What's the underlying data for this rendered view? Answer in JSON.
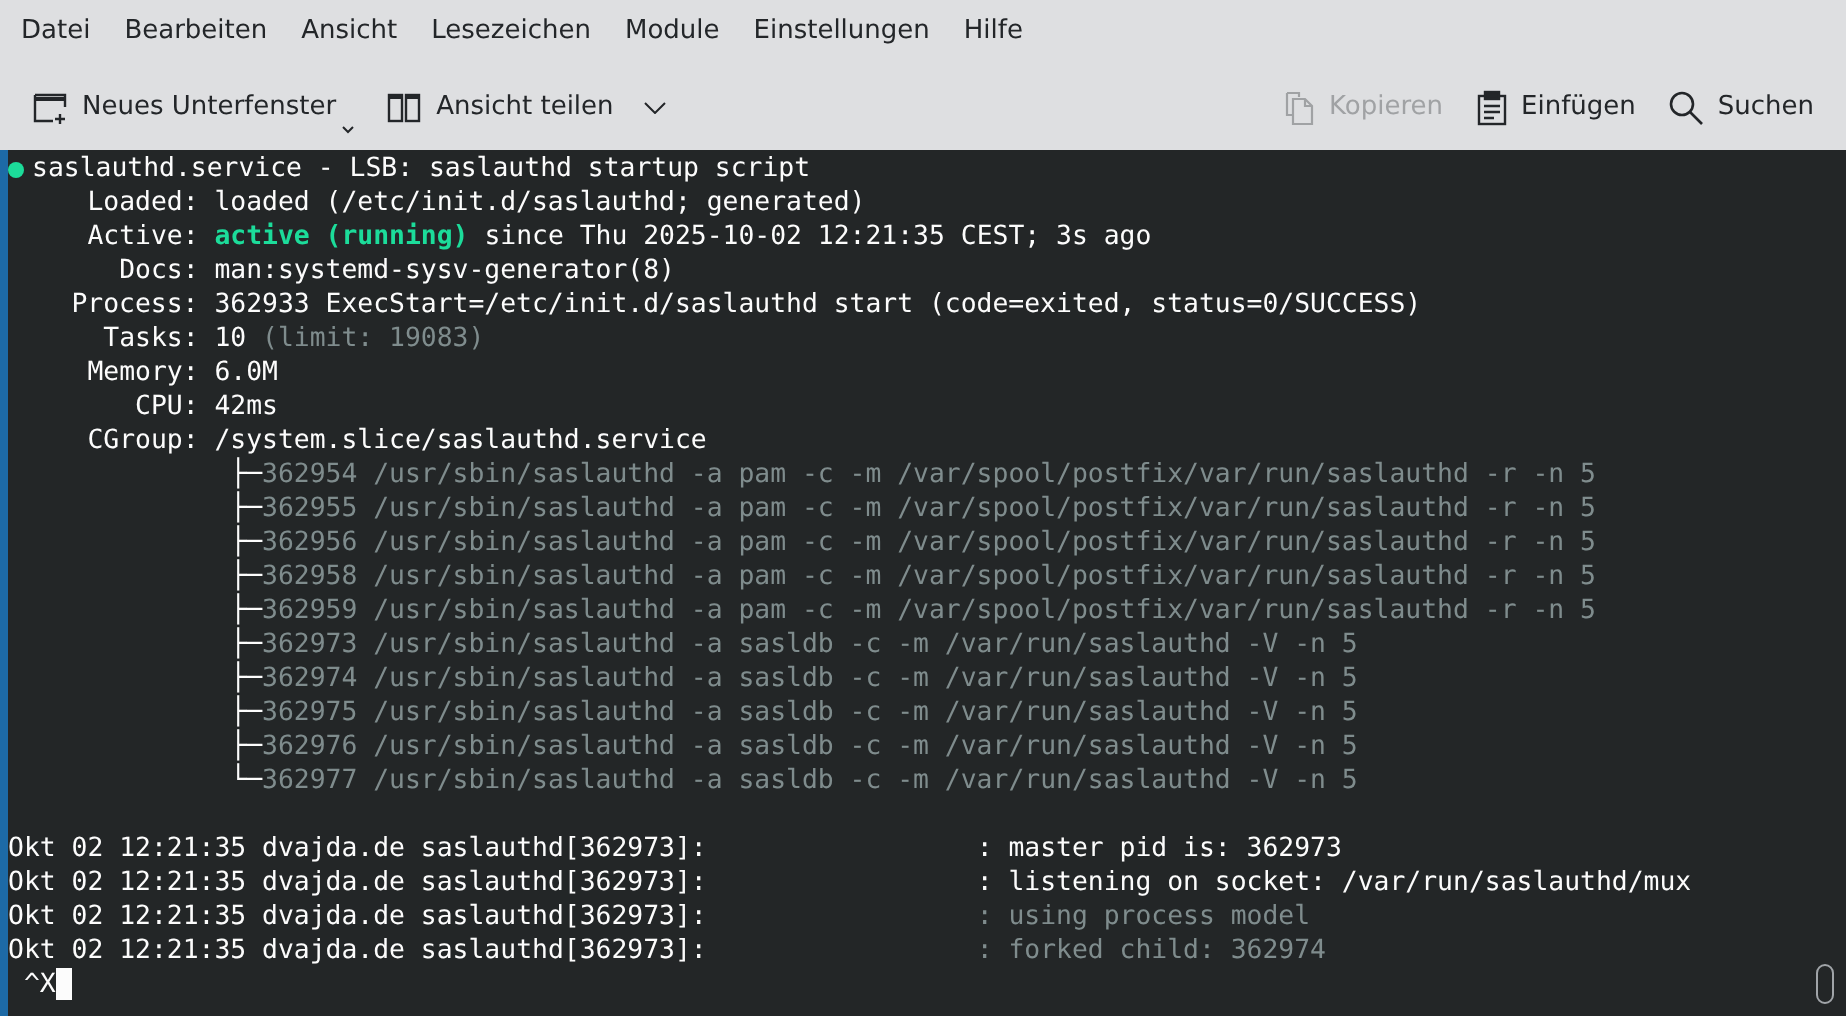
{
  "menu": [
    "Datei",
    "Bearbeiten",
    "Ansicht",
    "Lesezeichen",
    "Module",
    "Einstellungen",
    "Hilfe"
  ],
  "toolbar": [
    {
      "label": "Neues Unterfenster",
      "disabled": false
    },
    {
      "label": "Ansicht teilen",
      "disabled": false
    },
    {
      "label": "Kopieren",
      "disabled": true
    },
    {
      "label": "Einfügen",
      "disabled": false
    },
    {
      "label": "Suchen",
      "disabled": false
    }
  ],
  "terminal": {
    "lines": [
      {
        "kind": "status",
        "segments": [
          {
            "text": "saslauthd.service - LSB: saslauthd startup script",
            "kind": "plain"
          }
        ]
      },
      {
        "kind": "field",
        "label": "Loaded:",
        "segments": [
          {
            "text": "loaded (/etc/init.d/saslauthd; generated)",
            "kind": "plain"
          }
        ]
      },
      {
        "kind": "field",
        "label": "Active:",
        "segments": [
          {
            "text": "active (running)",
            "kind": "state"
          },
          {
            "text": " since Thu 2025-10-02 12:21:35 CEST; 3s ago",
            "kind": "plain"
          }
        ]
      },
      {
        "kind": "field",
        "label": "Docs:",
        "segments": [
          {
            "text": "man:systemd-sysv-generator(8)",
            "kind": "plain"
          }
        ]
      },
      {
        "kind": "field",
        "label": "Process:",
        "segments": [
          {
            "text": "362933 ExecStart=/etc/init.d/saslauthd start (code=exited, status=0/SUCCESS)",
            "kind": "plain"
          }
        ]
      },
      {
        "kind": "field",
        "label": "Tasks:",
        "segments": [
          {
            "text": "10",
            "kind": "plain"
          },
          {
            "text": " (limit: 19083)",
            "kind": "dim"
          }
        ]
      },
      {
        "kind": "field",
        "label": "Memory:",
        "segments": [
          {
            "text": "6.0M",
            "kind": "plain"
          }
        ]
      },
      {
        "kind": "field",
        "label": "CPU:",
        "segments": [
          {
            "text": "42ms",
            "kind": "plain"
          }
        ]
      },
      {
        "kind": "field",
        "label": "CGroup:",
        "segments": [
          {
            "text": "/system.slice/saslauthd.service",
            "kind": "plain"
          }
        ]
      },
      {
        "kind": "tree",
        "segments": [
          {
            "text": "├─",
            "kind": "plain"
          },
          {
            "text": "362954 /usr/sbin/saslauthd -a pam -c -m /var/spool/postfix/var/run/saslauthd -r -n 5",
            "kind": "dim"
          }
        ]
      },
      {
        "kind": "tree",
        "segments": [
          {
            "text": "├─",
            "kind": "plain"
          },
          {
            "text": "362955 /usr/sbin/saslauthd -a pam -c -m /var/spool/postfix/var/run/saslauthd -r -n 5",
            "kind": "dim"
          }
        ]
      },
      {
        "kind": "tree",
        "segments": [
          {
            "text": "├─",
            "kind": "plain"
          },
          {
            "text": "362956 /usr/sbin/saslauthd -a pam -c -m /var/spool/postfix/var/run/saslauthd -r -n 5",
            "kind": "dim"
          }
        ]
      },
      {
        "kind": "tree",
        "segments": [
          {
            "text": "├─",
            "kind": "plain"
          },
          {
            "text": "362958 /usr/sbin/saslauthd -a pam -c -m /var/spool/postfix/var/run/saslauthd -r -n 5",
            "kind": "dim"
          }
        ]
      },
      {
        "kind": "tree",
        "segments": [
          {
            "text": "├─",
            "kind": "plain"
          },
          {
            "text": "362959 /usr/sbin/saslauthd -a pam -c -m /var/spool/postfix/var/run/saslauthd -r -n 5",
            "kind": "dim"
          }
        ]
      },
      {
        "kind": "tree",
        "segments": [
          {
            "text": "├─",
            "kind": "plain"
          },
          {
            "text": "362973 /usr/sbin/saslauthd -a sasldb -c -m /var/run/saslauthd -V -n 5",
            "kind": "dim"
          }
        ]
      },
      {
        "kind": "tree",
        "segments": [
          {
            "text": "├─",
            "kind": "plain"
          },
          {
            "text": "362974 /usr/sbin/saslauthd -a sasldb -c -m /var/run/saslauthd -V -n 5",
            "kind": "dim"
          }
        ]
      },
      {
        "kind": "tree",
        "segments": [
          {
            "text": "├─",
            "kind": "plain"
          },
          {
            "text": "362975 /usr/sbin/saslauthd -a sasldb -c -m /var/run/saslauthd -V -n 5",
            "kind": "dim"
          }
        ]
      },
      {
        "kind": "tree",
        "segments": [
          {
            "text": "├─",
            "kind": "plain"
          },
          {
            "text": "362976 /usr/sbin/saslauthd -a sasldb -c -m /var/run/saslauthd -V -n 5",
            "kind": "dim"
          }
        ]
      },
      {
        "kind": "tree",
        "segments": [
          {
            "text": "└─",
            "kind": "plain"
          },
          {
            "text": "362977 /usr/sbin/saslauthd -a sasldb -c -m /var/run/saslauthd -V -n 5",
            "kind": "dim"
          }
        ]
      },
      {
        "kind": "blank"
      },
      {
        "kind": "log",
        "segments": [
          {
            "text": "Okt 02 12:21:35 dvajda.de saslauthd[362973]:",
            "kind": "plain"
          },
          {
            "text": ": master pid is: 362973",
            "kind": "plain"
          }
        ]
      },
      {
        "kind": "log",
        "segments": [
          {
            "text": "Okt 02 12:21:35 dvajda.de saslauthd[362973]:",
            "kind": "plain"
          },
          {
            "text": ": listening on socket: /var/run/saslauthd/mux",
            "kind": "plain"
          }
        ]
      },
      {
        "kind": "log",
        "segments": [
          {
            "text": "Okt 02 12:21:35 dvajda.de saslauthd[362973]:",
            "kind": "plain"
          },
          {
            "text": ": using process model",
            "kind": "dim"
          }
        ]
      },
      {
        "kind": "log",
        "segments": [
          {
            "text": "Okt 02 12:21:35 dvajda.de saslauthd[362973]:",
            "kind": "plain"
          },
          {
            "text": ": forked child: 362974",
            "kind": "dim"
          }
        ]
      },
      {
        "kind": "prompt",
        "segments": [
          {
            "text": "^X",
            "kind": "plain"
          }
        ]
      }
    ]
  }
}
